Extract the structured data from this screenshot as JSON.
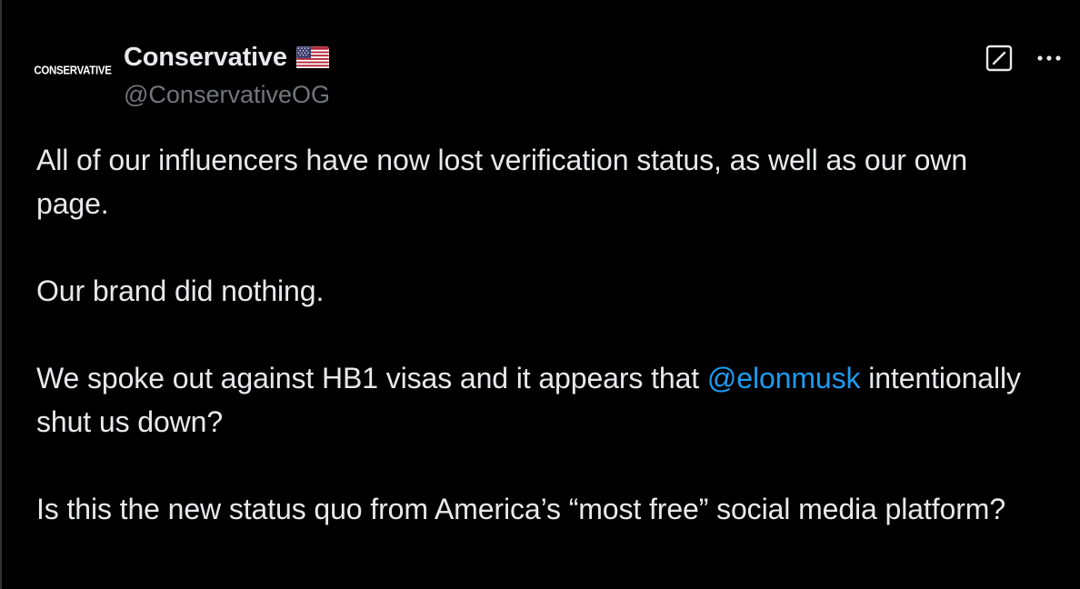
{
  "author": {
    "avatar_text": "CONSERVATIVE",
    "display_name": "Conservative",
    "flag_emoji": "🇺🇸",
    "handle": "@ConservativeOG"
  },
  "actions": {
    "grok_icon": "grok-icon",
    "more_icon": "more-horizontal-icon"
  },
  "tweet": {
    "paragraphs": [
      {
        "text": "All of our influencers have now lost verification status, as well as our own page."
      },
      {
        "text": "Our brand did nothing."
      },
      {
        "before": "We spoke out against HB1 visas and it appears that ",
        "mention": "@elonmusk",
        "after": " intentionally shut us down?"
      },
      {
        "text": "Is this the new status quo from America’s “most free” social media platform?"
      }
    ]
  },
  "colors": {
    "background": "#000000",
    "text": "#e7e9ea",
    "secondary": "#71767b",
    "link": "#1d9bf0"
  }
}
